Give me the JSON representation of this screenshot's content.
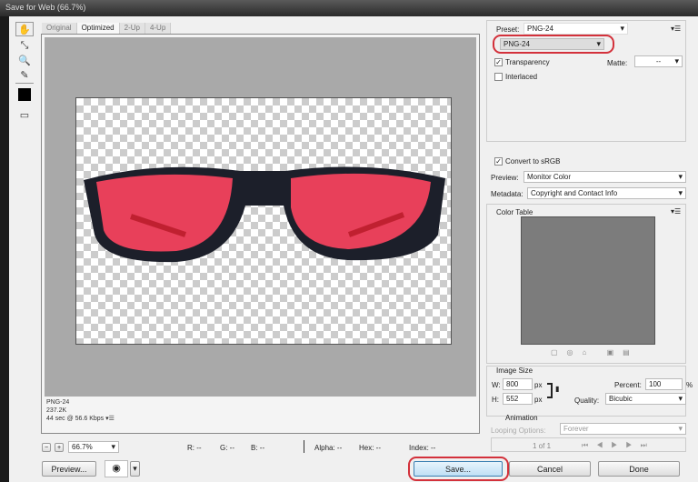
{
  "title": "Save for Web (66.7%)",
  "tabs": [
    "Original",
    "Optimized",
    "2-Up",
    "4-Up"
  ],
  "info": {
    "format": "PNG-24",
    "size": "237.2K",
    "time": "44 sec @ 56.6 Kbps"
  },
  "status": {
    "zoom": "66.7%",
    "r": "R: --",
    "g": "G: --",
    "b": "B: --",
    "alpha": "Alpha: --",
    "hex": "Hex: --",
    "index": "Index: --"
  },
  "buttons": {
    "preview": "Preview...",
    "save": "Save...",
    "cancel": "Cancel",
    "done": "Done"
  },
  "settings": {
    "preset_label": "Preset:",
    "preset_value": "PNG-24",
    "format": "PNG-24",
    "transparency": "Transparency",
    "matte_label": "Matte:",
    "matte_value": "--",
    "interlaced": "Interlaced",
    "convert_srgb": "Convert to sRGB",
    "preview_label": "Preview:",
    "preview_value": "Monitor Color",
    "metadata_label": "Metadata:",
    "metadata_value": "Copyright and Contact Info",
    "color_table": "Color Table"
  },
  "image_size": {
    "title": "Image Size",
    "w_label": "W:",
    "w": "800",
    "h_label": "H:",
    "h": "552",
    "unit": "px",
    "percent_label": "Percent:",
    "percent": "100",
    "percent_unit": "%",
    "quality_label": "Quality:",
    "quality": "Bicubic"
  },
  "animation": {
    "title": "Animation",
    "looping_label": "Looping Options:",
    "looping": "Forever",
    "frame": "1 of 1"
  },
  "colors": {
    "highlight": "#d3313b",
    "lens": "#e8405a"
  }
}
